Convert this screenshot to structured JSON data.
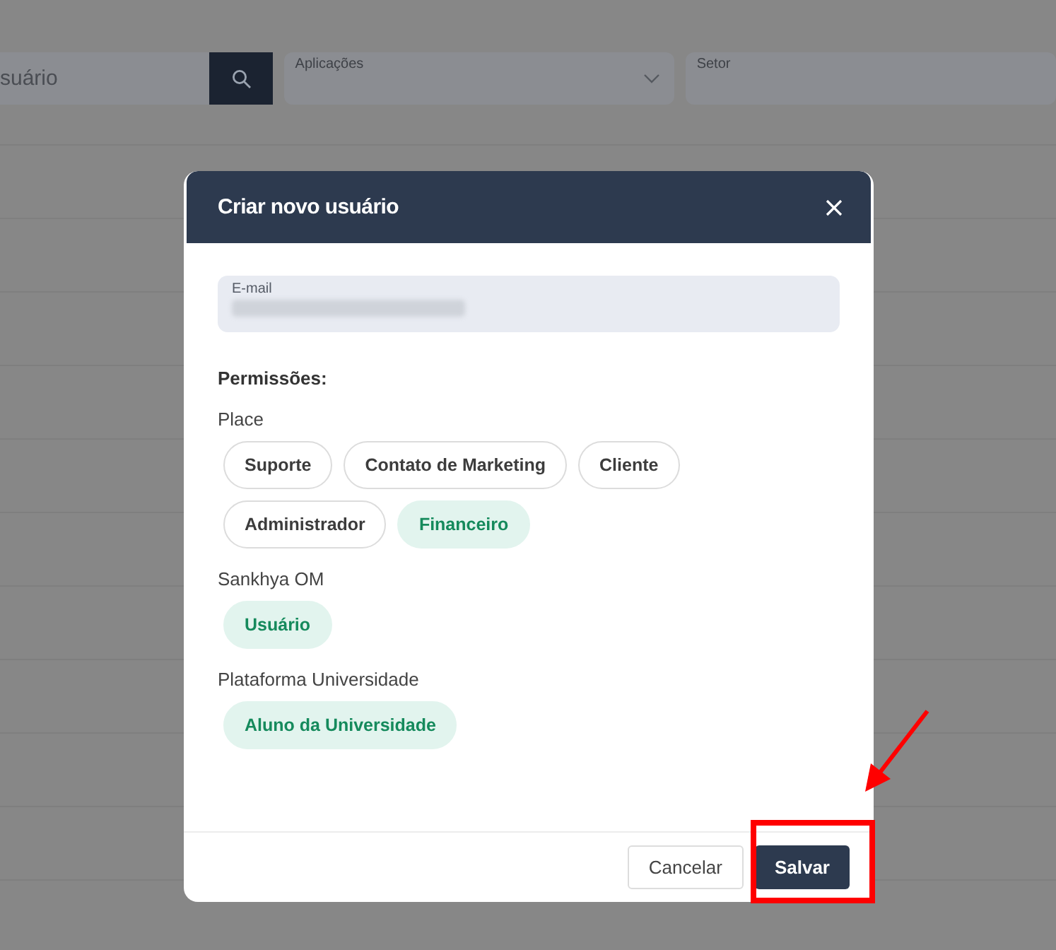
{
  "background": {
    "search": {
      "placeholder": "suário"
    },
    "filters": [
      {
        "label": "Aplicações",
        "kind": "dropdown"
      },
      {
        "label": "Setor",
        "kind": "text"
      }
    ]
  },
  "dialog": {
    "title": "Criar novo usuário",
    "email_label": "E-mail",
    "permissions_label": "Permissões:",
    "groups": [
      {
        "name": "Place",
        "roles": [
          {
            "label": "Suporte",
            "selected": false
          },
          {
            "label": "Contato de Marketing",
            "selected": false
          },
          {
            "label": "Cliente",
            "selected": false
          },
          {
            "label": "Administrador",
            "selected": false
          },
          {
            "label": "Financeiro",
            "selected": true
          }
        ]
      },
      {
        "name": "Sankhya OM",
        "roles": [
          {
            "label": "Usuário",
            "selected": true
          }
        ]
      },
      {
        "name": "Plataforma Universidade",
        "roles": [
          {
            "label": "Aluno da Universidade",
            "selected": true
          }
        ]
      }
    ],
    "buttons": [
      {
        "label": "Cancelar",
        "kind": "secondary"
      },
      {
        "label": "Salvar",
        "kind": "primary"
      }
    ]
  }
}
